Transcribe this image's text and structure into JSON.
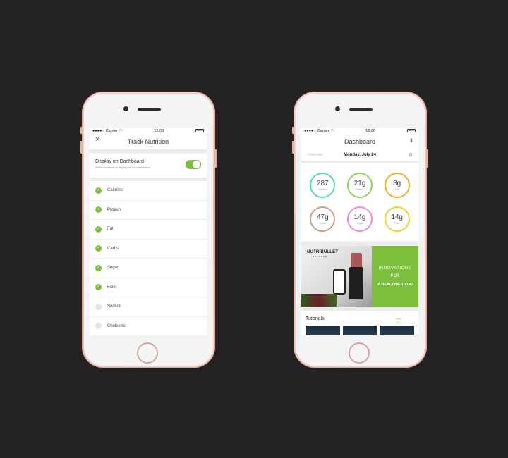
{
  "colors": {
    "accent": "#7cbf3d",
    "background": "#242222"
  },
  "status": {
    "carrier": "Carrier",
    "time": "12:00"
  },
  "left": {
    "title": "Track Nutrition",
    "close_icon": "close-icon",
    "toggle": {
      "title": "Display on Dashboard",
      "subtitle": "Select nutrients to display on the dashboard",
      "on": true
    },
    "nutrients": [
      {
        "label": "Calories",
        "checked": true
      },
      {
        "label": "Protein",
        "checked": true
      },
      {
        "label": "Fat",
        "checked": true
      },
      {
        "label": "Carbs",
        "checked": true
      },
      {
        "label": "Sugar",
        "checked": true
      },
      {
        "label": "Fiber",
        "checked": true
      },
      {
        "label": "Sodium",
        "checked": false
      },
      {
        "label": "Cholestrol",
        "checked": false
      }
    ]
  },
  "right": {
    "title": "Dashboard",
    "yesterday": "Yesterday",
    "date": "Monday, July 24",
    "rings": [
      {
        "value": "287",
        "name": "Calories",
        "color": "#5fd3bd"
      },
      {
        "value": "21g",
        "name": "Protein",
        "color": "#8fd35f"
      },
      {
        "value": "8g",
        "name": "Fat",
        "color": "#f0a830"
      },
      {
        "value": "47g",
        "name": "Carbs",
        "color": "#c9a08c"
      },
      {
        "value": "14g",
        "name": "Sugar",
        "color": "#f08bd8"
      },
      {
        "value": "14g",
        "name": "Fiber",
        "color": "#f0d030"
      }
    ],
    "banner": {
      "brand": "NUTRIBULLET",
      "brand_sub": "BALANCE",
      "line1": "INNOVATIONS",
      "line2": "FOR",
      "line3": "A HEALTHIER YOU"
    },
    "tutorials": {
      "title": "Tutorials",
      "see_all": "SEE ALL"
    }
  }
}
